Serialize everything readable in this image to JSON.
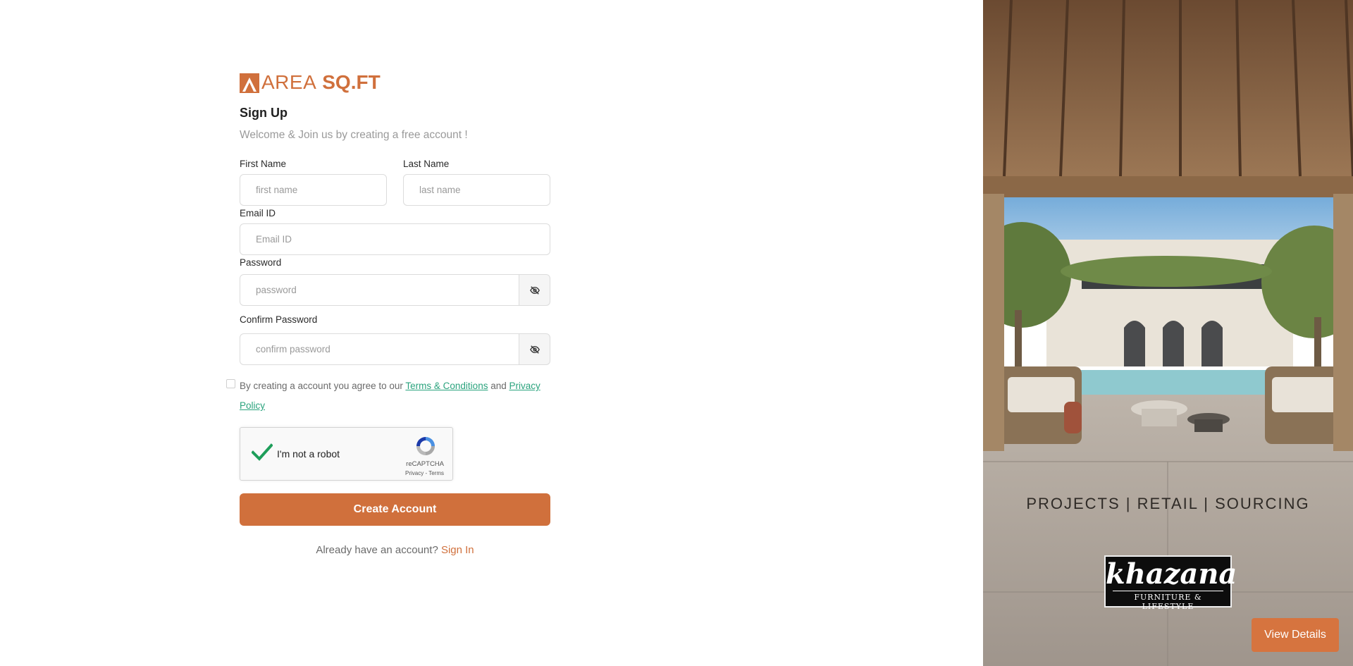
{
  "brand": {
    "logo_word_a": "AREA",
    "logo_word_b": "SQ.FT",
    "color": "#d0703c"
  },
  "form": {
    "title": "Sign Up",
    "subtitle": "Welcome & Join us by creating a free account !",
    "first_name": {
      "label": "First Name",
      "placeholder": "first name"
    },
    "last_name": {
      "label": "Last Name",
      "placeholder": "last name"
    },
    "email": {
      "label": "Email ID",
      "placeholder": "Email ID"
    },
    "password": {
      "label": "Password",
      "placeholder": "password",
      "toggle_icon": "eye-off-icon"
    },
    "confirm_password": {
      "label": "Confirm Password",
      "placeholder": "confirm password",
      "toggle_icon": "eye-off-icon"
    },
    "terms": {
      "prefix": "By creating a account you agree to our ",
      "terms_link": "Terms & Conditions",
      "middle": " and ",
      "privacy_link": "Privacy Policy",
      "checked": false,
      "link_color": "#2aa37d"
    },
    "captcha": {
      "label": "I'm not a robot",
      "checked": true,
      "brand": "reCAPTCHA",
      "links": "Privacy - Terms"
    },
    "submit_label": "Create Account",
    "signin_prompt": "Already have an account?",
    "signin_link": "Sign In"
  },
  "promo": {
    "tagline": "PROJECTS | RETAIL | SOURCING",
    "brand_name": "khazana",
    "brand_sub": "FURNITURE & LIFESTYLE",
    "cta_label": "View Details"
  }
}
